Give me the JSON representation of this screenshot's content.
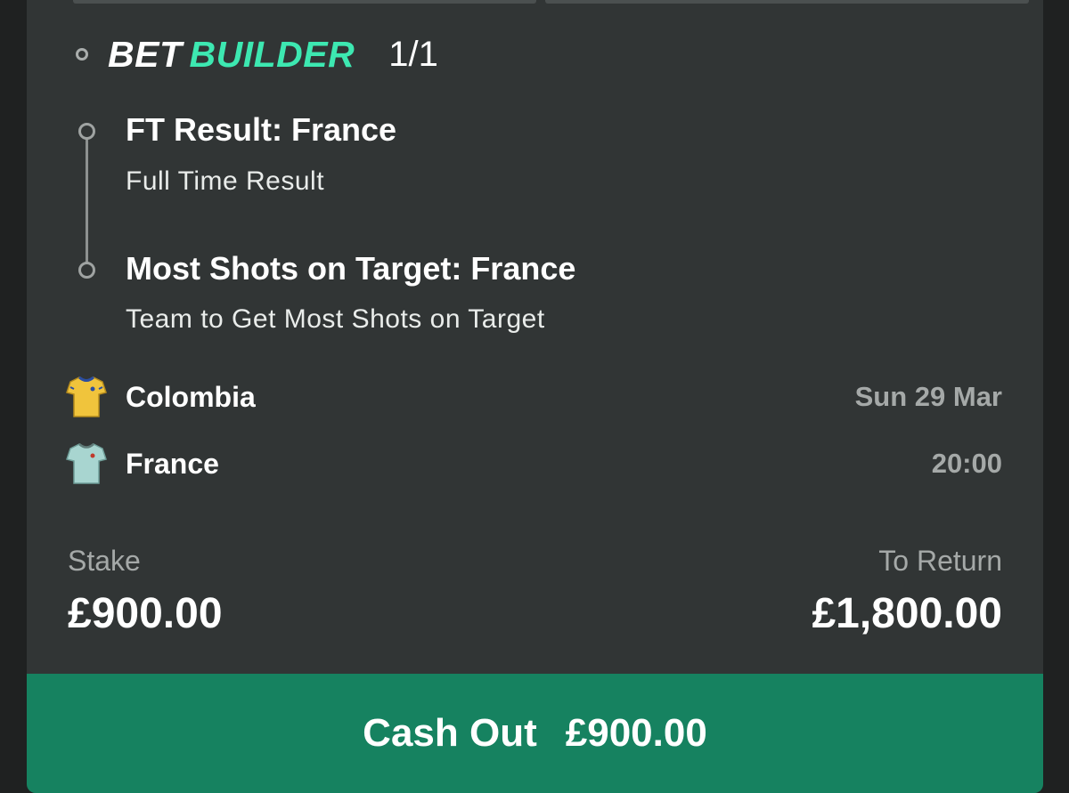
{
  "bet": {
    "brand_primary": "BET",
    "brand_accent": "BUILDER",
    "count": "1/1",
    "legs": [
      {
        "title": "FT Result: France",
        "subtitle": "Full Time Result"
      },
      {
        "title": "Most Shots on Target: France",
        "subtitle": "Team to Get Most Shots on Target"
      }
    ]
  },
  "match": {
    "home": {
      "name": "Colombia",
      "meta": "Sun 29 Mar",
      "shirt_icon": "yellow-shirt-icon"
    },
    "away": {
      "name": "France",
      "meta": "20:00",
      "shirt_icon": "light-blue-shirt-icon"
    }
  },
  "summary": {
    "stake_label": "Stake",
    "stake_value": "£900.00",
    "return_label": "To Return",
    "return_value": "£1,800.00"
  },
  "cashout": {
    "label": "Cash Out",
    "amount": "£900.00"
  },
  "colors": {
    "accent": "#3de8b1",
    "cashout_bg": "#168260",
    "card_bg": "#313535",
    "muted_text": "#a5a9a8"
  }
}
